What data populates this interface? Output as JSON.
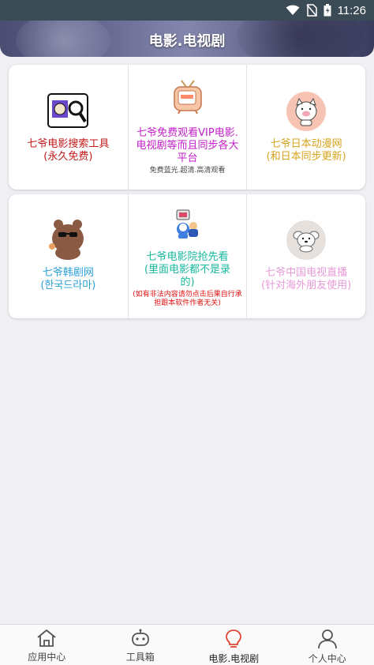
{
  "status": {
    "time": "11:26"
  },
  "header": {
    "title": "电影.电视剧"
  },
  "cards": [
    {
      "label": "七爷电影搜索工具\n(永久免费)",
      "color": "#c21a1a"
    },
    {
      "label": "七爷免费观看VIP电影.\n电视剧等而且同步各大\n平台",
      "sub": "免费蓝光.超清.高清观看",
      "color": "#c21ec9"
    },
    {
      "label": "七爷日本动漫网\n(和日本同步更新)",
      "color": "#d6a31c"
    },
    {
      "label": "七爷韩剧网\n(한국드라마)",
      "color": "#2a9fd6"
    },
    {
      "label": "七爷电影院抢先看\n(里面电影都不是录\n的)",
      "sub": "(如有非法内容请勿点击后果自行承\n担跟本软件作者无关)",
      "color": "#16b89c"
    },
    {
      "label": "七爷中国电视直播\n(针对海外朋友使用)",
      "color": "#e69ad8"
    }
  ],
  "tabs": [
    {
      "label": "应用中心",
      "icon": "home-icon"
    },
    {
      "label": "工具箱",
      "icon": "robot-icon"
    },
    {
      "label": "电影.电视剧",
      "icon": "bulb-icon",
      "active": true
    },
    {
      "label": "个人中心",
      "icon": "user-icon"
    }
  ]
}
